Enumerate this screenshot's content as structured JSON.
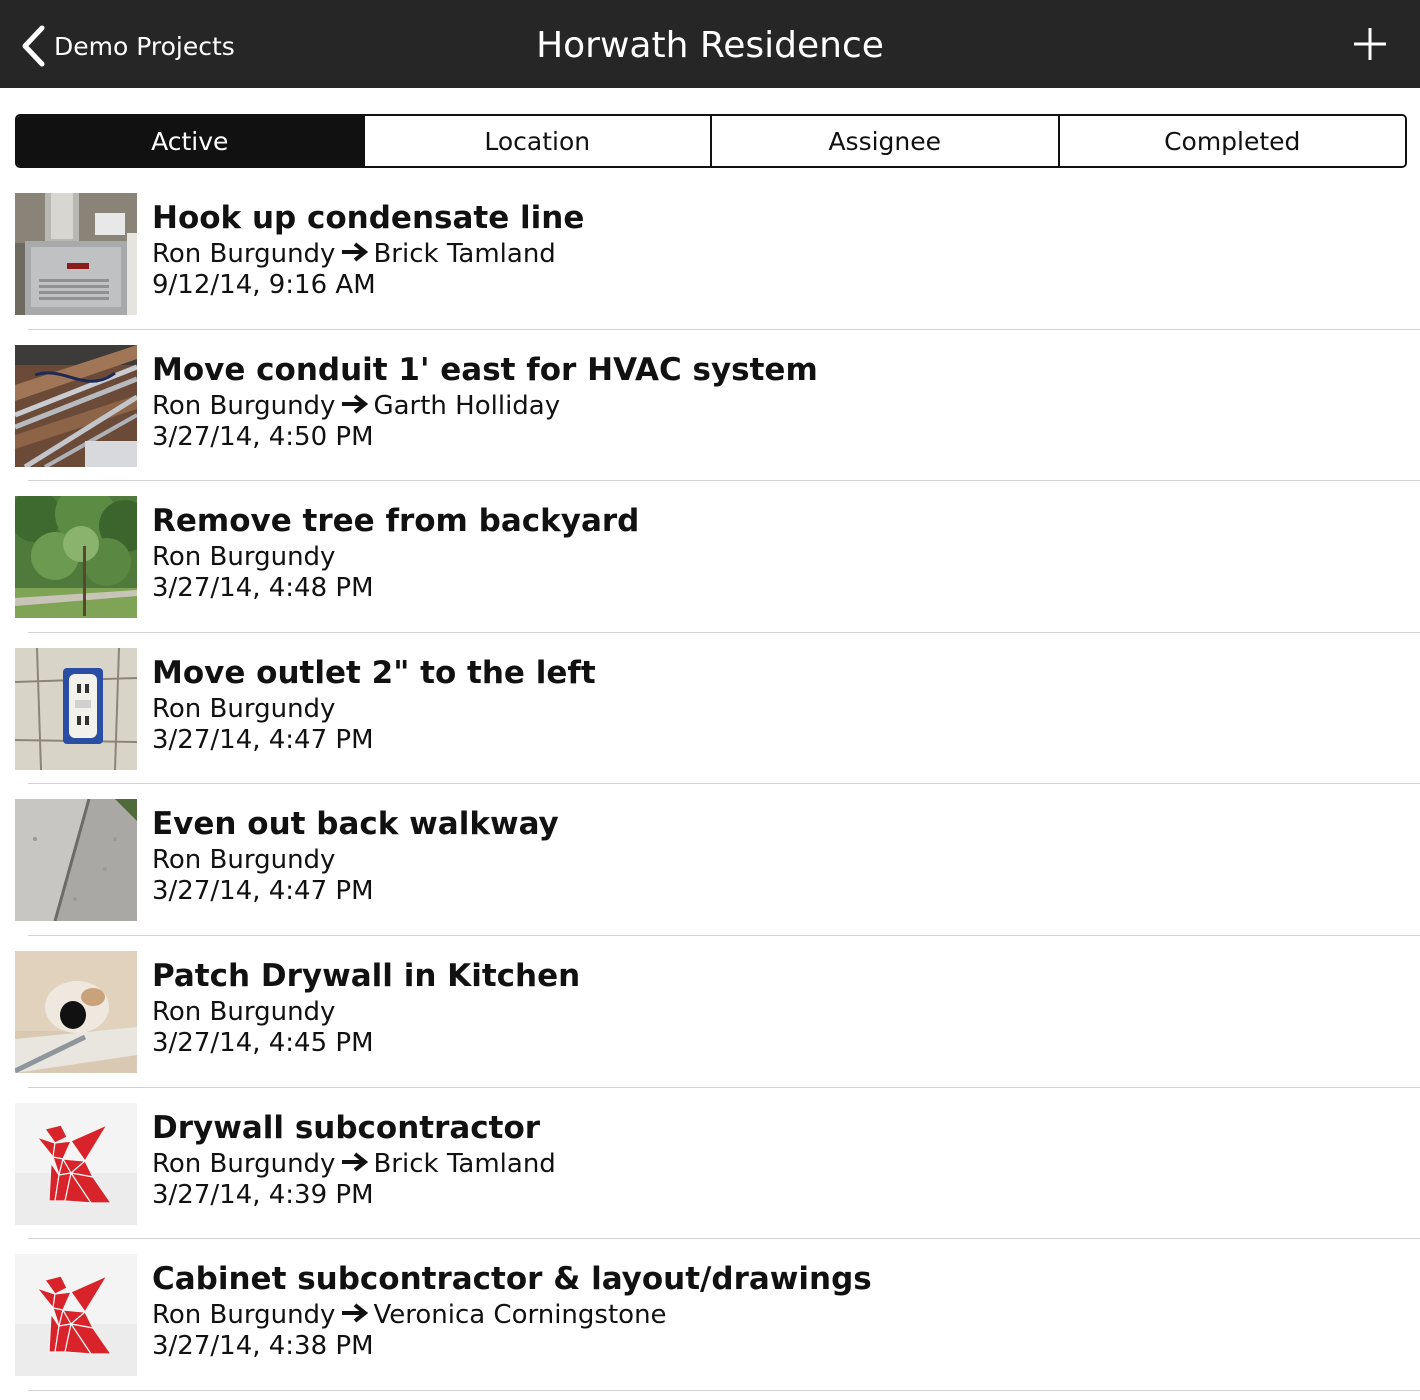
{
  "navbar": {
    "back_label": "Demo Projects",
    "title": "Horwath Residence",
    "back_icon": "chevron-left-icon",
    "add_icon": "plus-icon"
  },
  "tabs": [
    {
      "label": "Active",
      "active": true
    },
    {
      "label": "Location",
      "active": false
    },
    {
      "label": "Assignee",
      "active": false
    },
    {
      "label": "Completed",
      "active": false
    }
  ],
  "tasks": [
    {
      "title": "Hook up condensate line",
      "creator": "Ron Burgundy",
      "assignee": "Brick Tamland",
      "date": "9/12/14, 9:16 AM",
      "thumb": "furnace"
    },
    {
      "title": "Move conduit 1' east for HVAC system",
      "creator": "Ron Burgundy",
      "assignee": "Garth Holliday",
      "date": "3/27/14, 4:50 PM",
      "thumb": "conduit"
    },
    {
      "title": "Remove tree from backyard",
      "creator": "Ron Burgundy",
      "assignee": "",
      "date": "3/27/14, 4:48 PM",
      "thumb": "tree"
    },
    {
      "title": "Move outlet 2\" to the left",
      "creator": "Ron Burgundy",
      "assignee": "",
      "date": "3/27/14, 4:47 PM",
      "thumb": "outlet"
    },
    {
      "title": "Even out back walkway",
      "creator": "Ron Burgundy",
      "assignee": "",
      "date": "3/27/14, 4:47 PM",
      "thumb": "walkway"
    },
    {
      "title": "Patch Drywall in Kitchen",
      "creator": "Ron Burgundy",
      "assignee": "",
      "date": "3/27/14, 4:45 PM",
      "thumb": "drywall"
    },
    {
      "title": "Drywall subcontractor",
      "creator": "Ron Burgundy",
      "assignee": "Brick Tamland",
      "date": "3/27/14, 4:39 PM",
      "thumb": "logo"
    },
    {
      "title": "Cabinet subcontractor & layout/drawings",
      "creator": "Ron Burgundy",
      "assignee": "Veronica Corningstone",
      "date": "3/27/14, 4:38 PM",
      "thumb": "logo"
    }
  ],
  "colors": {
    "navbar_bg": "#262626",
    "tab_active_bg": "#111111",
    "divider": "#d2d2d2",
    "logo_red": "#d8232a"
  }
}
